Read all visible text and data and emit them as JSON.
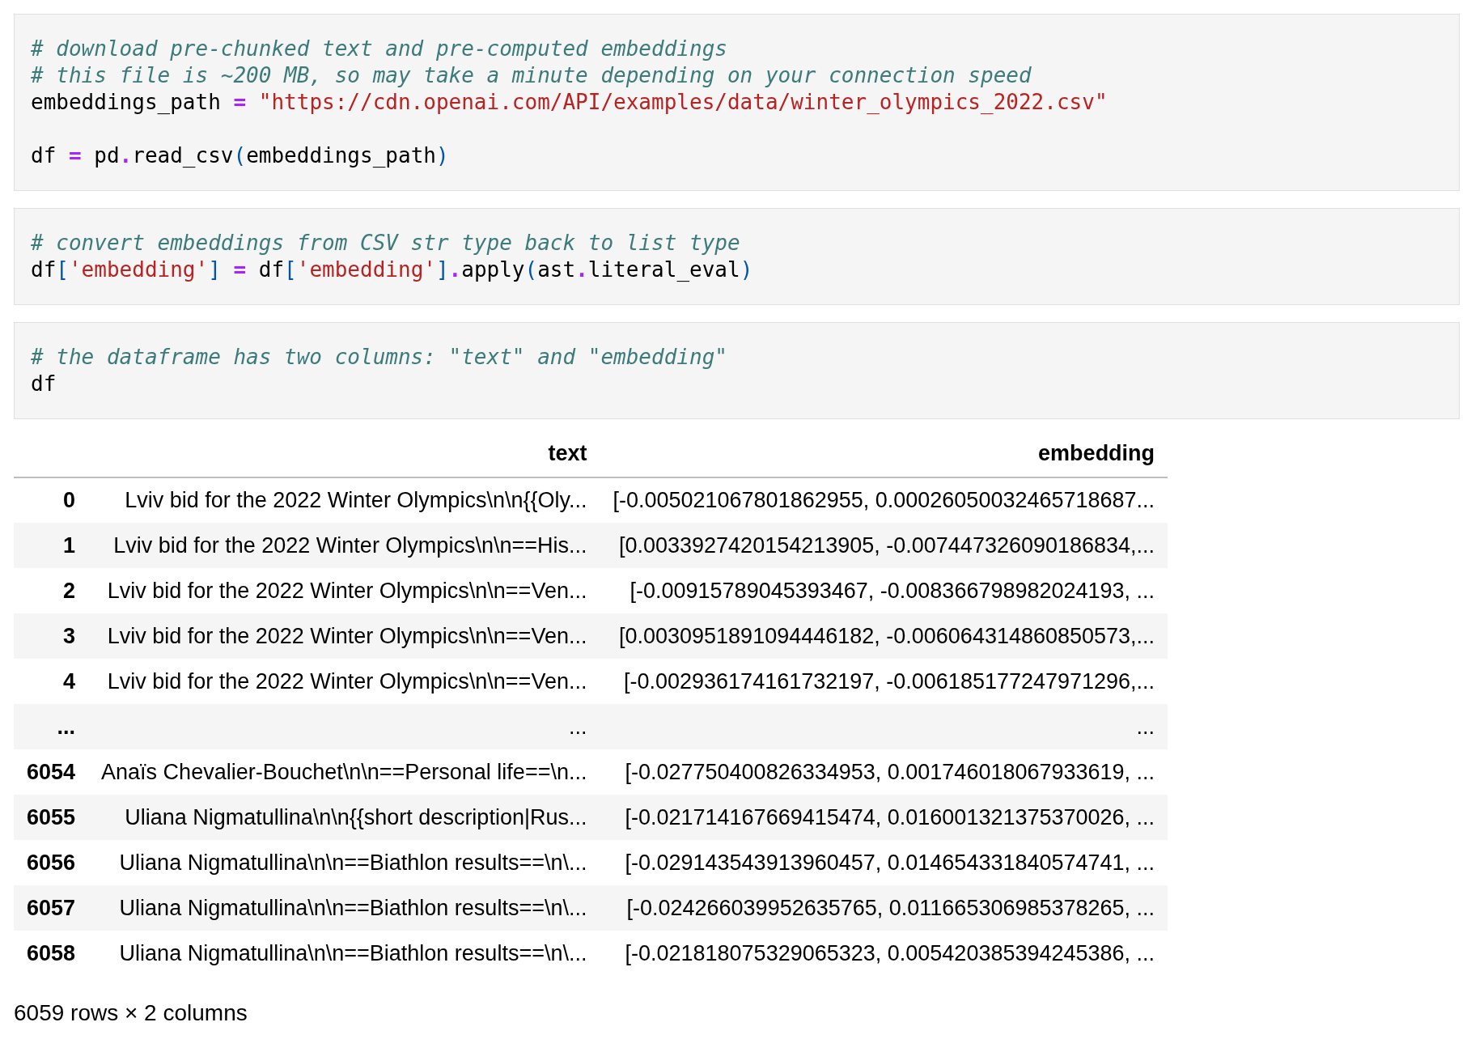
{
  "cells": [
    {
      "blocks": [
        {
          "lines": [
            {
              "tokens": [
                {
                  "kind": "comment",
                  "text": "# download pre-chunked text and pre-computed embeddings"
                }
              ]
            },
            {
              "tokens": [
                {
                  "kind": "comment",
                  "text": "# this file is ~200 MB, so may take a minute depending on your connection speed"
                }
              ]
            },
            {
              "tokens": [
                {
                  "kind": "plain",
                  "text": "embeddings_path "
                },
                {
                  "kind": "op",
                  "text": "= "
                },
                {
                  "kind": "string",
                  "text": "\"https://cdn.openai.com/API/examples/data/winter_olympics_2022.csv\""
                }
              ]
            }
          ]
        },
        {
          "lines": [
            {
              "tokens": [
                {
                  "kind": "plain",
                  "text": "df "
                },
                {
                  "kind": "op",
                  "text": "="
                },
                {
                  "kind": "plain",
                  "text": " pd"
                },
                {
                  "kind": "op",
                  "text": "."
                },
                {
                  "kind": "plain",
                  "text": "read_csv"
                },
                {
                  "kind": "bracket",
                  "text": "("
                },
                {
                  "kind": "plain",
                  "text": "embeddings_path"
                },
                {
                  "kind": "bracket",
                  "text": ")"
                }
              ]
            }
          ]
        }
      ]
    },
    {
      "blocks": [
        {
          "lines": [
            {
              "tokens": [
                {
                  "kind": "comment",
                  "text": "# convert embeddings from CSV str type back to list type"
                }
              ]
            },
            {
              "tokens": [
                {
                  "kind": "plain",
                  "text": "df"
                },
                {
                  "kind": "bracket",
                  "text": "["
                },
                {
                  "kind": "string",
                  "text": "'embedding'"
                },
                {
                  "kind": "bracket",
                  "text": "] "
                },
                {
                  "kind": "op",
                  "text": "="
                },
                {
                  "kind": "plain",
                  "text": " df"
                },
                {
                  "kind": "bracket",
                  "text": "["
                },
                {
                  "kind": "string",
                  "text": "'embedding'"
                },
                {
                  "kind": "bracket",
                  "text": "]"
                },
                {
                  "kind": "op",
                  "text": "."
                },
                {
                  "kind": "plain",
                  "text": "apply"
                },
                {
                  "kind": "bracket",
                  "text": "("
                },
                {
                  "kind": "plain",
                  "text": "ast"
                },
                {
                  "kind": "op",
                  "text": "."
                },
                {
                  "kind": "plain",
                  "text": "literal_eval"
                },
                {
                  "kind": "bracket",
                  "text": ")"
                }
              ]
            }
          ]
        }
      ]
    },
    {
      "blocks": [
        {
          "lines": [
            {
              "tokens": [
                {
                  "kind": "comment",
                  "text": "# the dataframe has two columns: \"text\" and \"embedding\""
                }
              ]
            },
            {
              "tokens": [
                {
                  "kind": "plain",
                  "text": "df"
                }
              ]
            }
          ]
        }
      ]
    }
  ],
  "table": {
    "columns": [
      "text",
      "embedding"
    ],
    "rows": [
      {
        "index": "0",
        "text": "Lviv bid for the 2022 Winter Olympics\\n\\n{{Oly...",
        "embedding": "[-0.005021067801862955, 0.00026050032465718687..."
      },
      {
        "index": "1",
        "text": "Lviv bid for the 2022 Winter Olympics\\n\\n==His...",
        "embedding": "[0.0033927420154213905, -0.007447326090186834,..."
      },
      {
        "index": "2",
        "text": "Lviv bid for the 2022 Winter Olympics\\n\\n==Ven...",
        "embedding": "[-0.00915789045393467, -0.008366798982024193, ..."
      },
      {
        "index": "3",
        "text": "Lviv bid for the 2022 Winter Olympics\\n\\n==Ven...",
        "embedding": "[0.0030951891094446182, -0.006064314860850573,..."
      },
      {
        "index": "4",
        "text": "Lviv bid for the 2022 Winter Olympics\\n\\n==Ven...",
        "embedding": "[-0.002936174161732197, -0.006185177247971296,..."
      },
      {
        "index": "...",
        "text": "...",
        "embedding": "..."
      },
      {
        "index": "6054",
        "text": "Anaïs Chevalier-Bouchet\\n\\n==Personal life==\\n...",
        "embedding": "[-0.027750400826334953, 0.001746018067933619, ..."
      },
      {
        "index": "6055",
        "text": "Uliana Nigmatullina\\n\\n{{short description|Rus...",
        "embedding": "[-0.021714167669415474, 0.016001321375370026, ..."
      },
      {
        "index": "6056",
        "text": "Uliana Nigmatullina\\n\\n==Biathlon results==\\n\\...",
        "embedding": "[-0.029143543913960457, 0.014654331840574741, ..."
      },
      {
        "index": "6057",
        "text": "Uliana Nigmatullina\\n\\n==Biathlon results==\\n\\...",
        "embedding": "[-0.024266039952635765, 0.011665306985378265, ..."
      },
      {
        "index": "6058",
        "text": "Uliana Nigmatullina\\n\\n==Biathlon results==\\n\\...",
        "embedding": "[-0.021818075329065323, 0.005420385394245386, ..."
      }
    ]
  },
  "footer": "6059 rows × 2 columns"
}
